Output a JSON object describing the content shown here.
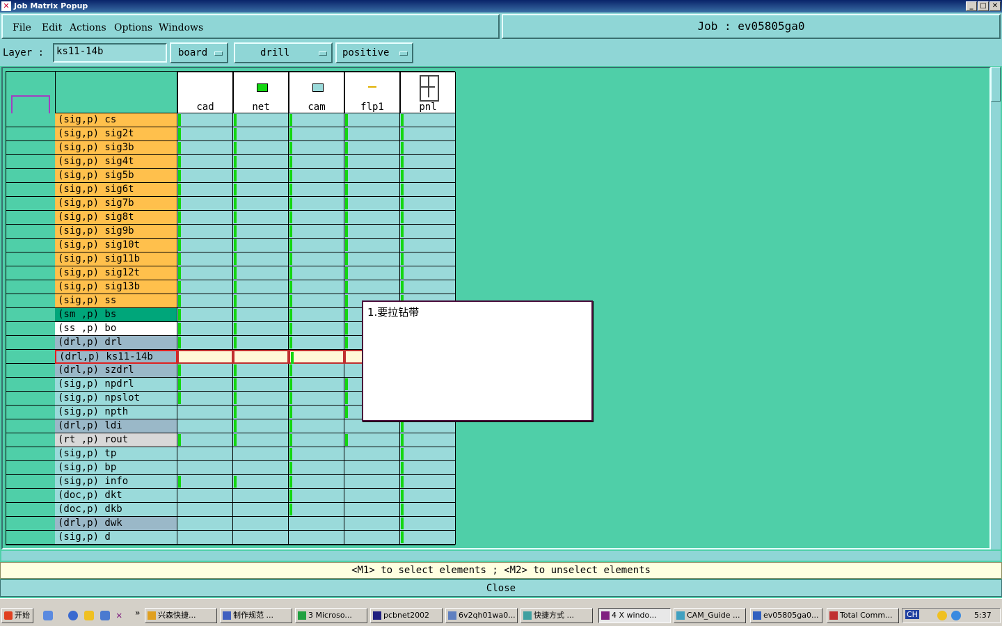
{
  "window": {
    "title": "Job Matrix Popup"
  },
  "menu": [
    "File",
    "Edit",
    "Actions",
    "Options",
    "Windows"
  ],
  "job": {
    "label": "Job  :  ev05805ga0"
  },
  "layer": {
    "label": "Layer :",
    "value": "ks11-14b"
  },
  "dropdowns": {
    "context": "board",
    "type": "drill",
    "polarity": "positive"
  },
  "steps": [
    "cad",
    "net",
    "cam",
    "flp1",
    "pnl"
  ],
  "layers": [
    {
      "name": "(sig,p) cs",
      "color": "#ffc04c",
      "marks": [
        1,
        1,
        1,
        1,
        1
      ]
    },
    {
      "name": "(sig,p) sig2t",
      "color": "#ffc04c",
      "marks": [
        1,
        1,
        1,
        1,
        1
      ]
    },
    {
      "name": "(sig,p) sig3b",
      "color": "#ffc04c",
      "marks": [
        1,
        1,
        1,
        1,
        1
      ]
    },
    {
      "name": "(sig,p) sig4t",
      "color": "#ffc04c",
      "marks": [
        1,
        1,
        1,
        1,
        1
      ]
    },
    {
      "name": "(sig,p) sig5b",
      "color": "#ffc04c",
      "marks": [
        1,
        1,
        1,
        1,
        1
      ]
    },
    {
      "name": "(sig,p) sig6t",
      "color": "#ffc04c",
      "marks": [
        1,
        1,
        1,
        1,
        1
      ]
    },
    {
      "name": "(sig,p) sig7b",
      "color": "#ffc04c",
      "marks": [
        1,
        1,
        1,
        1,
        1
      ]
    },
    {
      "name": "(sig,p) sig8t",
      "color": "#ffc04c",
      "marks": [
        1,
        1,
        1,
        1,
        1
      ]
    },
    {
      "name": "(sig,p) sig9b",
      "color": "#ffc04c",
      "marks": [
        1,
        1,
        1,
        1,
        1
      ]
    },
    {
      "name": "(sig,p) sig10t",
      "color": "#ffc04c",
      "marks": [
        1,
        1,
        1,
        1,
        1
      ]
    },
    {
      "name": "(sig,p) sig11b",
      "color": "#ffc04c",
      "marks": [
        1,
        1,
        1,
        1,
        1
      ]
    },
    {
      "name": "(sig,p) sig12t",
      "color": "#ffc04c",
      "marks": [
        1,
        1,
        1,
        1,
        1
      ]
    },
    {
      "name": "(sig,p) sig13b",
      "color": "#ffc04c",
      "marks": [
        1,
        1,
        1,
        1,
        1
      ]
    },
    {
      "name": "(sig,p) ss",
      "color": "#ffc04c",
      "marks": [
        1,
        1,
        1,
        1,
        1
      ]
    },
    {
      "name": "(sm ,p) bs",
      "color": "#00a67a",
      "marks": [
        1,
        1,
        1,
        1,
        1
      ]
    },
    {
      "name": "(ss ,p) bo",
      "color": "#ffffff",
      "marks": [
        1,
        1,
        1,
        1,
        1
      ]
    },
    {
      "name": "(drl,p) drl",
      "color": "#9ab8c8",
      "marks": [
        1,
        1,
        1,
        1,
        1
      ]
    },
    {
      "name": "(drl,p) ks11-14b",
      "color": "#9ab8c8",
      "marks": [
        0,
        0,
        1,
        0,
        1
      ],
      "selected": true
    },
    {
      "name": "(drl,p) szdrl",
      "color": "#9ab8c8",
      "marks": [
        1,
        1,
        1,
        0,
        1
      ]
    },
    {
      "name": "(sig,p) npdrl",
      "color": "#9adada",
      "marks": [
        1,
        1,
        1,
        1,
        1
      ]
    },
    {
      "name": "(sig,p) npslot",
      "color": "#9adada",
      "marks": [
        1,
        1,
        1,
        1,
        1
      ]
    },
    {
      "name": "(sig,p) npth",
      "color": "#9adada",
      "marks": [
        0,
        1,
        1,
        1,
        1
      ]
    },
    {
      "name": "(drl,p) ldi",
      "color": "#9ab8c8",
      "marks": [
        0,
        1,
        1,
        0,
        1
      ]
    },
    {
      "name": "(rt ,p) rout",
      "color": "#d8d8d8",
      "marks": [
        1,
        1,
        1,
        1,
        1
      ]
    },
    {
      "name": "(sig,p) tp",
      "color": "#9adada",
      "marks": [
        0,
        0,
        1,
        0,
        1
      ]
    },
    {
      "name": "(sig,p) bp",
      "color": "#9adada",
      "marks": [
        0,
        0,
        1,
        0,
        1
      ]
    },
    {
      "name": "(sig,p) info",
      "color": "#9adada",
      "marks": [
        1,
        1,
        1,
        0,
        1
      ]
    },
    {
      "name": "(doc,p) dkt",
      "color": "#9adada",
      "marks": [
        0,
        0,
        1,
        0,
        1
      ]
    },
    {
      "name": "(doc,p) dkb",
      "color": "#9adada",
      "marks": [
        0,
        0,
        1,
        0,
        1
      ]
    },
    {
      "name": "(drl,p) dwk",
      "color": "#9ab8c8",
      "marks": [
        0,
        0,
        0,
        0,
        1
      ]
    },
    {
      "name": "(sig,p) d",
      "color": "#9adada",
      "marks": [
        0,
        0,
        0,
        0,
        1
      ]
    }
  ],
  "popup": {
    "text": "1.要拉钻带"
  },
  "status": "<M1> to select elements ; <M2> to unselect elements",
  "close_label": "Close",
  "taskbar": {
    "start": "开始",
    "buttons": [
      "兴森快捷...",
      "制作规范 ...",
      "3 Microso...",
      "pcbnet2002",
      "6v2qh01wa0...",
      "快捷方式 ...",
      "4 X windo...",
      "CAM_Guide ...",
      "ev05805ga0...",
      "Total Comm..."
    ],
    "active_index": 6,
    "lang": "CH",
    "clock": "5:37"
  },
  "colors": {
    "background": "#4fcfa8",
    "green_mark": "#13d610",
    "signal": "#ffc04c",
    "drill": "#9ab8c8"
  }
}
